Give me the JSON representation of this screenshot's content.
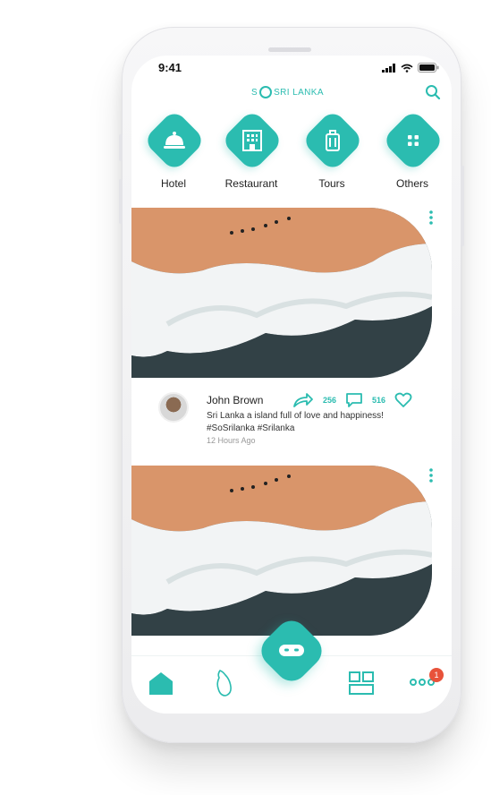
{
  "status_bar": {
    "time": "9:41"
  },
  "header": {
    "brand_prefix": "S",
    "brand_suffix": "SRI LANKA"
  },
  "categories": [
    {
      "label": "Hotel",
      "icon": "hotel-bell-icon"
    },
    {
      "label": "Restaurant",
      "icon": "building-icon"
    },
    {
      "label": "Tours",
      "icon": "luggage-icon"
    },
    {
      "label": "Others",
      "icon": "grid-dots-icon"
    }
  ],
  "posts": [
    {
      "author": "John Brown",
      "caption": "Sri Lanka a island full of love and happiness! #SoSrilanka #Srilanka",
      "timestamp": "12 Hours Ago",
      "comments": "256",
      "likes": "516"
    }
  ],
  "tabbar": {
    "items": [
      "home-icon",
      "sri-lanka-map-icon",
      "fab-bot-icon",
      "feed-layout-icon",
      "more-icon"
    ],
    "notification_count": "1"
  },
  "colors": {
    "accent": "#2bbcb0",
    "badge": "#e8523a"
  }
}
